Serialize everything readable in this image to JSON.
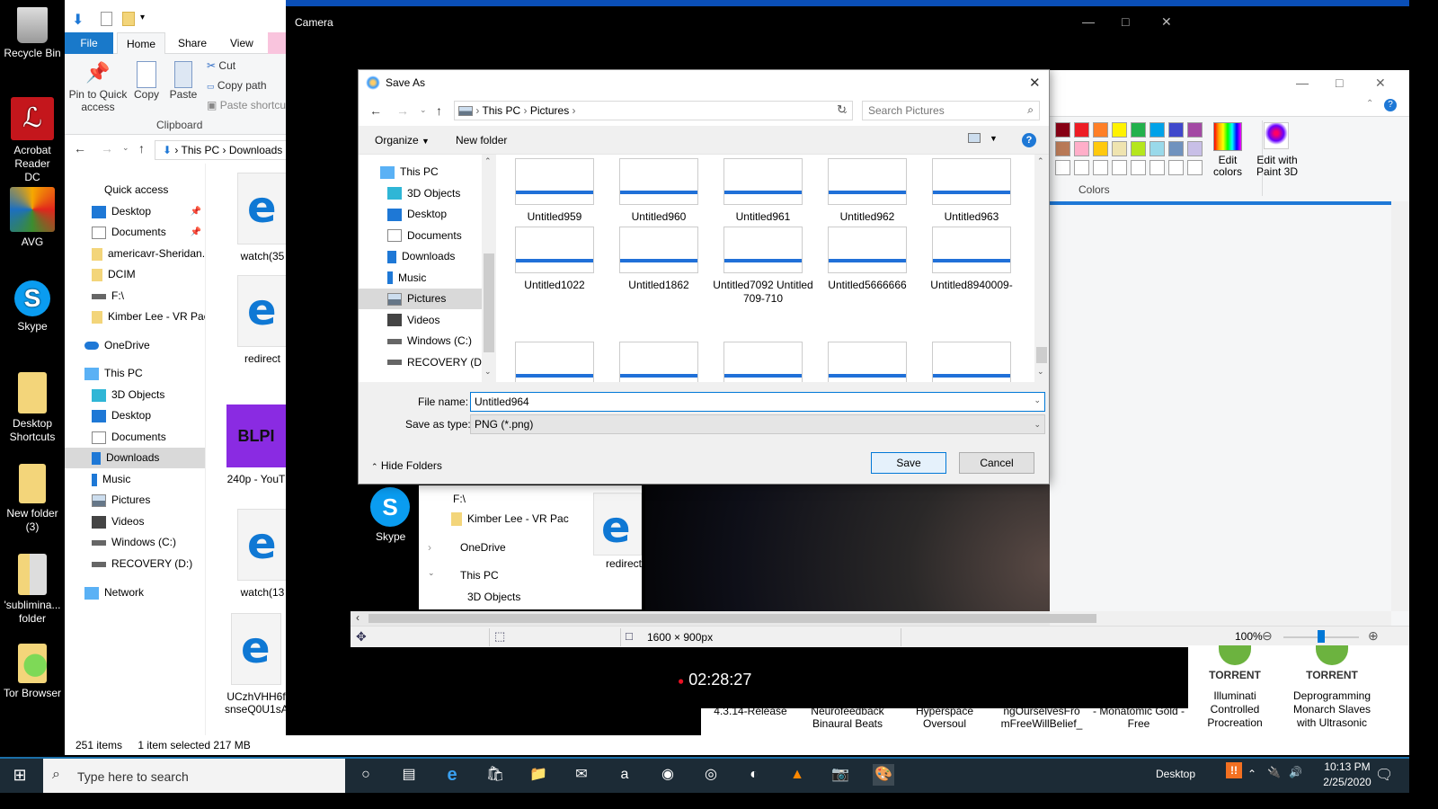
{
  "desktop": {
    "icons": [
      {
        "label": "Recycle Bin",
        "icon": "recycle-bin-icon"
      },
      {
        "label": "Acrobat Reader DC",
        "icon": "acrobat-icon"
      },
      {
        "label": "AVG",
        "icon": "avg-icon"
      },
      {
        "label": "Skype",
        "icon": "skype-icon"
      },
      {
        "label": "Desktop Shortcuts",
        "icon": "folder-icon"
      },
      {
        "label": "New folder (3)",
        "icon": "folder-icon"
      },
      {
        "label": "'sublimina... folder",
        "icon": "folder-icon"
      },
      {
        "label": "Tor Browser",
        "icon": "folder-icon"
      }
    ]
  },
  "explorer": {
    "tabs": {
      "file": "File",
      "home": "Home",
      "share": "Share",
      "view": "View"
    },
    "ribbon": {
      "pin": "Pin to Quick access",
      "copy": "Copy",
      "paste": "Paste",
      "cut": "Cut",
      "copy_path": "Copy path",
      "paste_shortcut": "Paste shortcut",
      "group": "Clipboard"
    },
    "address": [
      "This PC",
      "Downloads"
    ],
    "nav": [
      {
        "label": "Quick access",
        "level": 0,
        "icon": "star-icon"
      },
      {
        "label": "Desktop",
        "level": 1,
        "icon": "desktop-icon",
        "pinned": true
      },
      {
        "label": "Documents",
        "level": 1,
        "icon": "documents-icon",
        "pinned": true
      },
      {
        "label": "americavr-Sheridan.",
        "level": 1,
        "icon": "folder-icon"
      },
      {
        "label": "DCIM",
        "level": 1,
        "icon": "folder-icon"
      },
      {
        "label": "F:\\",
        "level": 1,
        "icon": "drive-icon"
      },
      {
        "label": "Kimber Lee - VR Pac",
        "level": 1,
        "icon": "folder-icon"
      },
      {
        "label": "OneDrive",
        "level": 0,
        "icon": "cloud-icon"
      },
      {
        "label": "This PC",
        "level": 0,
        "icon": "computer-icon"
      },
      {
        "label": "3D Objects",
        "level": 1,
        "icon": "cube-icon"
      },
      {
        "label": "Desktop",
        "level": 1,
        "icon": "desktop-icon"
      },
      {
        "label": "Documents",
        "level": 1,
        "icon": "documents-icon"
      },
      {
        "label": "Downloads",
        "level": 1,
        "icon": "download-icon",
        "selected": true
      },
      {
        "label": "Music",
        "level": 1,
        "icon": "music-icon"
      },
      {
        "label": "Pictures",
        "level": 1,
        "icon": "pictures-icon"
      },
      {
        "label": "Videos",
        "level": 1,
        "icon": "videos-icon"
      },
      {
        "label": "Windows (C:)",
        "level": 1,
        "icon": "drive-icon"
      },
      {
        "label": "RECOVERY (D:)",
        "level": 1,
        "icon": "drive-icon"
      },
      {
        "label": "Network",
        "level": 0,
        "icon": "network-icon"
      }
    ],
    "files": [
      {
        "label": "watch(35"
      },
      {
        "label": "redirect"
      },
      {
        "label": "240p - YouT"
      },
      {
        "label": "watch(13"
      },
      {
        "label": "UCzhVHH6f snseQ0U1sA"
      }
    ],
    "status": {
      "items": "251 items",
      "selected": "1 item selected  217 MB"
    }
  },
  "camera": {
    "title": "Camera",
    "timer": "02:28:27",
    "rec_color": "#e81123"
  },
  "paint": {
    "colors_row1": [
      "#880015",
      "#ed1c24",
      "#ff7f27",
      "#fff200",
      "#22b14c",
      "#00a2e8",
      "#3f48cc",
      "#a349a4"
    ],
    "colors_row2": [
      "#b97a57",
      "#ffaec9",
      "#ffc90e",
      "#efe4b0",
      "#b5e61d",
      "#99d9ea",
      "#7092be",
      "#c8bfe7"
    ],
    "edit_colors": "Edit colors",
    "edit_paint3d": "Edit with Paint 3D",
    "colors_group": "Colors",
    "canvas_size": "1600 × 900px",
    "zoom": "100%",
    "zoom_level_fraction": 0.5
  },
  "saveas": {
    "title": "Save As",
    "breadcrumb": [
      "This PC",
      "Pictures"
    ],
    "search_placeholder": "Search Pictures",
    "organize": "Organize",
    "new_folder": "New folder",
    "tree": [
      {
        "label": "This PC",
        "icon": "computer-icon"
      },
      {
        "label": "3D Objects",
        "icon": "cube-icon"
      },
      {
        "label": "Desktop",
        "icon": "desktop-icon"
      },
      {
        "label": "Documents",
        "icon": "documents-icon"
      },
      {
        "label": "Downloads",
        "icon": "download-icon"
      },
      {
        "label": "Music",
        "icon": "music-icon"
      },
      {
        "label": "Pictures",
        "icon": "pictures-icon",
        "selected": true
      },
      {
        "label": "Videos",
        "icon": "videos-icon"
      },
      {
        "label": "Windows (C:)",
        "icon": "drive-icon"
      },
      {
        "label": "RECOVERY (D:)",
        "icon": "drive-icon"
      }
    ],
    "files": [
      {
        "label": "Untitled959"
      },
      {
        "label": "Untitled960"
      },
      {
        "label": "Untitled961"
      },
      {
        "label": "Untitled962"
      },
      {
        "label": "Untitled963"
      },
      {
        "label": "Untitled1022"
      },
      {
        "label": "Untitled1862"
      },
      {
        "label": "Untitled7092 Untitled 709-710"
      },
      {
        "label": "Untitled5666666"
      },
      {
        "label": "Untitled8940009-"
      }
    ],
    "file_name_label": "File name:",
    "file_name_value": "Untitled964",
    "save_type_label": "Save as type:",
    "save_type_value": "PNG (*.png)",
    "hide_folders": "Hide Folders",
    "save": "Save",
    "cancel": "Cancel"
  },
  "background_window": {
    "tree": [
      {
        "label": "F:\\"
      },
      {
        "label": "Kimber Lee - VR Pac"
      },
      {
        "label": "OneDrive"
      },
      {
        "label": "This PC"
      },
      {
        "label": "3D Objects"
      }
    ],
    "skype_label": "Skype",
    "file_label": "redirect"
  },
  "downloads_strip": {
    "items": [
      {
        "label": "4.3.14-Release"
      },
      {
        "label": "Neurofeedback Binaural Beats"
      },
      {
        "label": "Hyperspace Oversoul"
      },
      {
        "label": "ngOurselvesFro mFreeWillBelief_"
      },
      {
        "label": "- Monatomic Gold - Free"
      },
      {
        "label": "Illuminati Controlled Procreation",
        "badge": "TORRENT"
      },
      {
        "label": "Deprogramming Monarch Slaves with Ultrasonic",
        "badge": "TORRENT"
      }
    ]
  },
  "taskbar": {
    "search_placeholder": "Type here to search",
    "desktop_label": "Desktop",
    "time": "10:13 PM",
    "date": "2/25/2020",
    "apps": [
      "cortana-icon",
      "task-view-icon",
      "edge-icon",
      "store-icon",
      "file-explorer-icon",
      "mail-icon",
      "amazon-icon",
      "tripadvisor-icon",
      "webcam-icon",
      "color-app-icon",
      "vlc-icon",
      "camera-icon",
      "paint-icon"
    ]
  }
}
